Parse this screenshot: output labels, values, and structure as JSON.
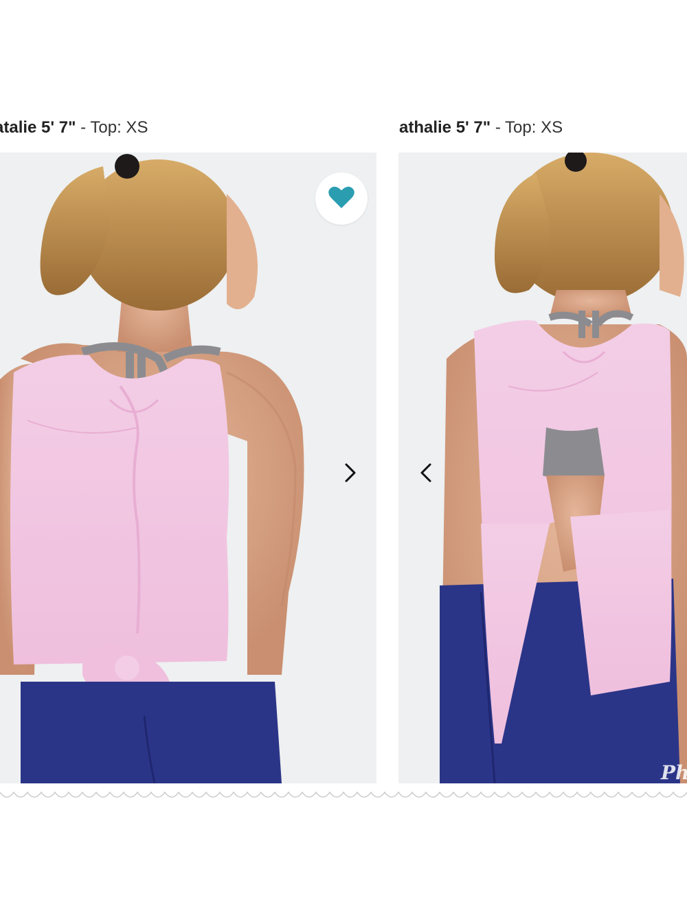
{
  "captions": [
    {
      "name": "athalie 5' 7\"",
      "size": "- Top: XS",
      "visible_name": "athalie 5' 7\""
    },
    {
      "name": "athalie 5' 7\"",
      "size": "- Top: XS"
    }
  ],
  "left_caption_visible": "atalie 5' 7\"",
  "gallery": {
    "favorite_icon": "heart-icon",
    "next_icon": "chevron-right-icon",
    "prev_icon": "chevron-left-icon",
    "watermark": "Ph"
  },
  "colors": {
    "heart": "#2a9db0",
    "tank": "#f2c7e3",
    "leggings": "#2b3588",
    "bra": "#8c8c90",
    "hair": "#c99a55",
    "skin": "#ddab8c",
    "background": "#eef0f1"
  }
}
